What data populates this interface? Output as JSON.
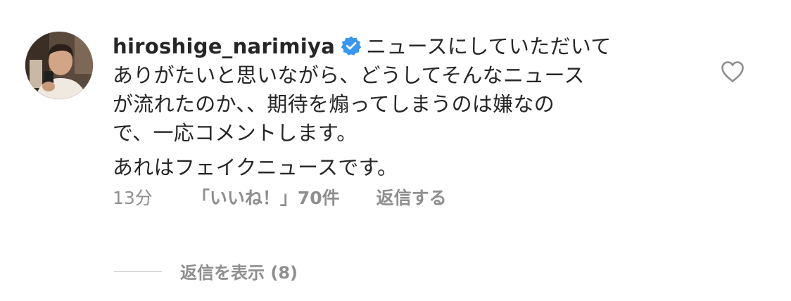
{
  "comment": {
    "username": "hiroshige_narimiya",
    "verified": true,
    "text_lines": [
      "ニュースにしていただいて",
      "ありがたいと思いながら、どうしてそんなニュース",
      "が流れたのか、、期待を煽ってしまうのは嫌なの",
      "で、一応コメントします。"
    ],
    "text_second": "あれはフェイクニュースです。",
    "time": "13分",
    "likes": "「いいね！」70件",
    "reply_label": "返信する",
    "view_replies": "返信を表示 (8)"
  },
  "icons": {
    "verified": "verified-badge-icon",
    "like": "heart-outline-icon",
    "avatar": "profile-photo"
  },
  "colors": {
    "text": "#262626",
    "secondary": "#8e8e8e",
    "verified": "#3897f0",
    "divider": "#dbdbdb"
  }
}
